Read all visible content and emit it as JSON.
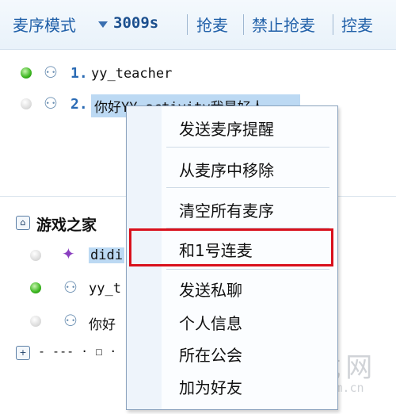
{
  "toolbar": {
    "mode_label": "麦序模式",
    "timer": "3009s",
    "grab_mic": "抢麦",
    "forbid_grab": "禁止抢麦",
    "control_mic": "控麦"
  },
  "queue": [
    {
      "num": "1.",
      "name": "yy_teacher",
      "status": "online"
    },
    {
      "num": "2.",
      "name": "你好YY_activity我是好人",
      "status": "offline"
    }
  ],
  "group": {
    "title": "游戏之家",
    "members": [
      {
        "name": "didi",
        "status": "offline"
      },
      {
        "name": "yy_t",
        "status": "online"
      },
      {
        "name": "你好",
        "status": "offline"
      }
    ],
    "collapsed_row": "- --- · ☐ ·"
  },
  "context_menu": {
    "items": [
      "发送麦序提醒",
      "从麦序中移除",
      "清空所有麦序",
      "和1号连麦",
      "发送私聊",
      "个人信息",
      "所在公会",
      "加为好友"
    ],
    "highlighted": "和1号连麦"
  },
  "watermark": {
    "brand": "PC下载网",
    "url": "www.pcsoft.com.cn"
  },
  "icons": {
    "mode_dropdown": "triangle-down-icon",
    "user": "user-figure-icon",
    "home": "home-icon",
    "expand": "plus-icon"
  },
  "colors": {
    "accent": "#1f5fa8",
    "highlight_border": "#d9101c",
    "online": "#3ab51e"
  }
}
